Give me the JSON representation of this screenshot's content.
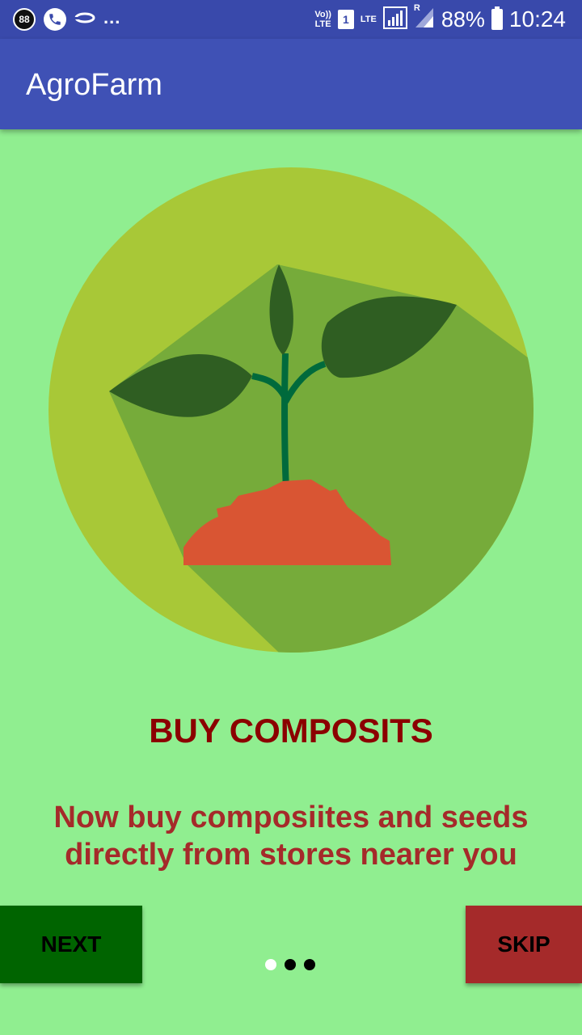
{
  "status_bar": {
    "notification_badge": "88",
    "more_indicator": "...",
    "volte_top": "Vo))",
    "volte_bottom": "LTE",
    "sim_slot": "1",
    "lte": "LTE",
    "roaming": "R",
    "battery": "88%",
    "time": "10:24"
  },
  "app_bar": {
    "title": "AgroFarm"
  },
  "onboarding": {
    "headline": "BUY COMPOSITS",
    "description": "Now buy composiites and seeds directly from stores nearer you",
    "pager": {
      "total": 3,
      "active_index": 0
    }
  },
  "buttons": {
    "next": "NEXT",
    "skip": "SKIP"
  },
  "colors": {
    "status_bar": "#3949AB",
    "app_bar": "#3F51B5",
    "background": "#90EE90",
    "headline": "#8B0000",
    "description": "#A52A2A",
    "next_button": "#006400",
    "skip_button": "#A52A2A"
  }
}
